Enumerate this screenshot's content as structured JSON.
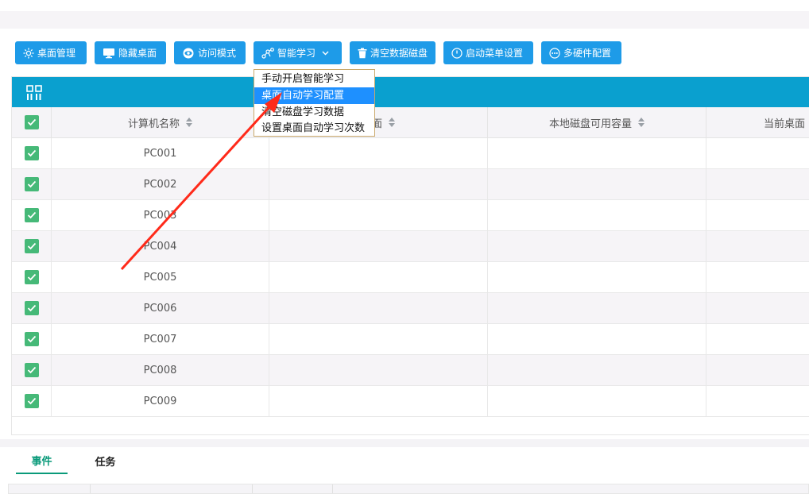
{
  "toolbar": {
    "buttons": [
      {
        "label": "桌面管理",
        "icon": "gear-icon"
      },
      {
        "label": "隐藏桌面",
        "icon": "monitor-icon"
      },
      {
        "label": "访问模式",
        "icon": "eye-icon"
      },
      {
        "label": "智能学习",
        "icon": "network-icon"
      },
      {
        "label": "清空数据磁盘",
        "icon": "trash-icon"
      },
      {
        "label": "启动菜单设置",
        "icon": "power-icon"
      },
      {
        "label": "多硬件配置",
        "icon": "more-icon"
      }
    ]
  },
  "dropdown": {
    "items": [
      "手动开启智能学习",
      "桌面自动学习配置",
      "清空磁盘学习数据",
      "设置桌面自动学习次数"
    ],
    "active_index": 1
  },
  "grid": {
    "columns": [
      "计算机名称",
      "桌面",
      "本地磁盘可用容量",
      "当前桌面"
    ],
    "rows": [
      {
        "name": "PC001",
        "checked": true
      },
      {
        "name": "PC002",
        "checked": true
      },
      {
        "name": "PC003",
        "checked": true
      },
      {
        "name": "PC004",
        "checked": true
      },
      {
        "name": "PC005",
        "checked": true
      },
      {
        "name": "PC006",
        "checked": true
      },
      {
        "name": "PC007",
        "checked": true
      },
      {
        "name": "PC008",
        "checked": true
      },
      {
        "name": "PC009",
        "checked": true
      }
    ]
  },
  "tabs": {
    "items": [
      "事件",
      "任务"
    ],
    "active_index": 0
  },
  "colors": {
    "button": "#1e9be8",
    "header_bar": "#0aa0cf",
    "checkbox": "#46b978",
    "dropdown_active": "#1e90ff",
    "tab_active": "#0a9a7a",
    "annotation_arrow": "#ff2a1a"
  }
}
